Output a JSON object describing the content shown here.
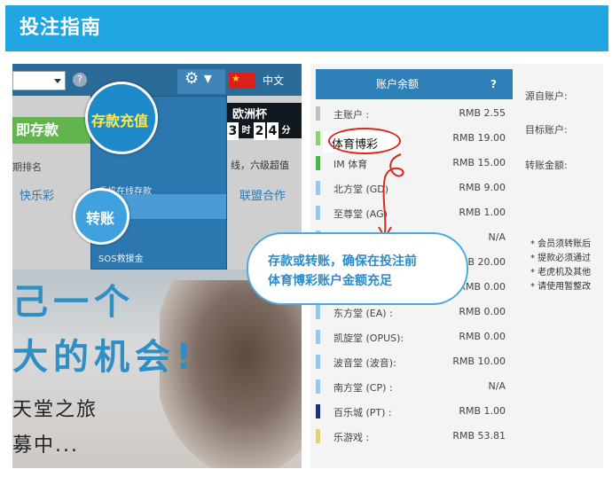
{
  "header": {
    "title": "投注指南"
  },
  "left": {
    "lang": "中文",
    "green_btn": "即存款",
    "text_row": "期排名",
    "link": "快乐彩",
    "euro_title": "欧洲杯",
    "digits": [
      "3",
      "时",
      "2",
      "4",
      "分"
    ],
    "notes": "线，六级超值",
    "alliance": "联盟合作",
    "dropdown": {
      "item1": "手机在线存款",
      "item2": "提款",
      "item3": "SOS救援金"
    },
    "big1": "己一个",
    "big2": "大的机会!",
    "small1": "天堂之旅",
    "small2": "募中..."
  },
  "callouts": {
    "deposit": "存款充值",
    "transfer": "转账"
  },
  "right": {
    "header_title": "账户余额",
    "help": "?",
    "rows": [
      {
        "name": "主账户  :",
        "value": "RMB 2.55",
        "color": "#bfbfbf"
      },
      {
        "name": "",
        "value": "RMB 19.00",
        "color": "#8bd17c"
      },
      {
        "name": "IM 体育",
        "value": "RMB 15.00",
        "color": "#4fb24a"
      },
      {
        "name": "北方堂 (GD)",
        "value": "RMB 9.00",
        "color": "#98c8e8"
      },
      {
        "name": "至尊堂 (AG)",
        "value": "RMB 1.00",
        "color": "#98c8e8"
      },
      {
        "name": "",
        "value": "N/A",
        "color": "#98c8e8"
      },
      {
        "name": "",
        "value": "RMB 20.00",
        "color": "#98c8e8"
      },
      {
        "name": "",
        "value": "RMB 0.00",
        "color": "#98c8e8"
      },
      {
        "name": "东方堂 (EA)  :",
        "value": "RMB 0.00",
        "color": "#98c8e8"
      },
      {
        "name": "凯旋堂 (OPUS):",
        "value": "RMB 0.00",
        "color": "#98c8e8"
      },
      {
        "name": "波音堂 (波音):",
        "value": "RMB 10.00",
        "color": "#98c8e8"
      },
      {
        "name": "南方堂 (CP)  :",
        "value": "N/A",
        "color": "#98c8e8"
      },
      {
        "name": "百乐城 (PT)  :",
        "value": "RMB 1.00",
        "color": "#1d2f7a"
      },
      {
        "name": "乐游戏   :",
        "value": "RMB 53.81",
        "color": "#e3d27a"
      }
    ],
    "from_label": "源自账户:",
    "to_label": "目标账户:",
    "amount_label": "转账金额:",
    "notes": [
      "* 会员须转账后",
      "* 提款必须通过",
      "* 老虎机及其他",
      "* 请使用暂整改"
    ],
    "highlight": "体育博彩",
    "bubble_line1": "存款或转账，确保在投注前",
    "bubble_line2": "体育博彩账户金额充足"
  }
}
